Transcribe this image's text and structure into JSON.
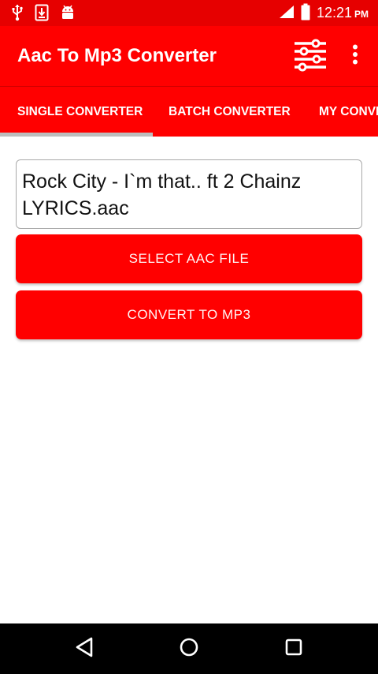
{
  "status_bar": {
    "time": "12:21",
    "ampm": "PM",
    "icons": [
      "usb-icon",
      "download-icon",
      "android-icon",
      "signal-icon",
      "battery-icon"
    ]
  },
  "toolbar": {
    "title": "Aac To Mp3 Converter",
    "icons": [
      "equalizer-settings-icon",
      "more-vert-icon"
    ]
  },
  "tabs": [
    {
      "label": "SINGLE CONVERTER",
      "selected": true
    },
    {
      "label": "BATCH CONVERTER",
      "selected": false
    },
    {
      "label": "MY CONVERTED FILES",
      "selected": false
    }
  ],
  "file_field": {
    "value": "Rock City - I`m that.. ft 2 Chainz LYRICS.aac"
  },
  "buttons": {
    "select_label": "SELECT AAC FILE",
    "convert_label": "CONVERT TO MP3"
  },
  "nav_bar": {
    "icons": [
      "back-icon",
      "home-icon",
      "recents-icon"
    ]
  },
  "colors": {
    "primary": "#ff0000",
    "status_bar": "#e60000",
    "tab_indicator": "#bdbdbd",
    "nav_bar": "#000000"
  }
}
